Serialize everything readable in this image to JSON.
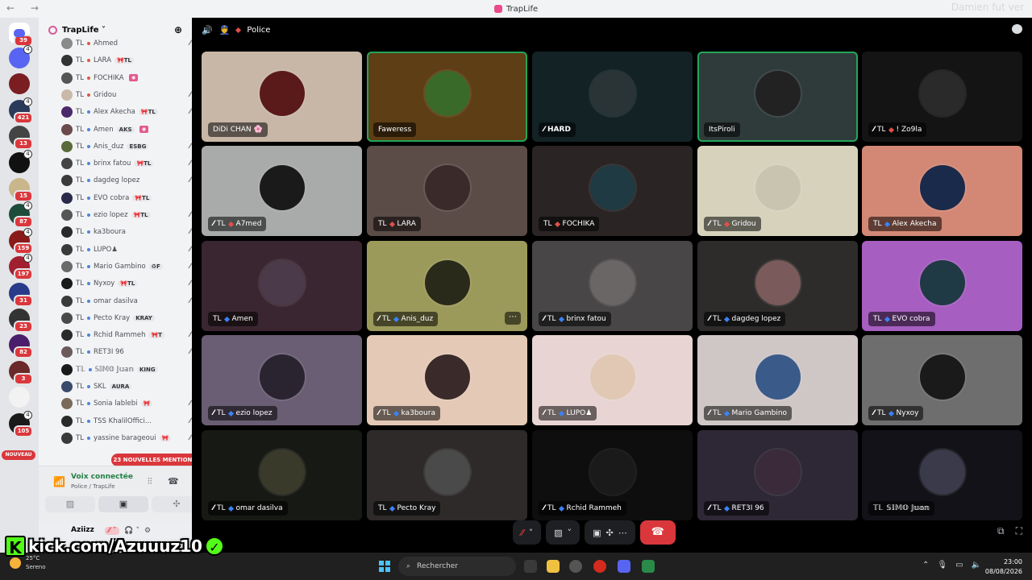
{
  "window": {
    "title": "TrapLife",
    "nav_back": "←",
    "nav_forward": "→",
    "watermark": "Damien fut ver"
  },
  "rail": {
    "discord_badge": "39",
    "nouveau": "NOUVEAU",
    "servers": [
      {
        "color": "#5865f2",
        "badge": "",
        "vc": "4"
      },
      {
        "color": "#7a1e22",
        "badge": "",
        "vc": ""
      },
      {
        "color": "#2a3a5a",
        "badge": "421",
        "vc": "4"
      },
      {
        "color": "#444444",
        "badge": "13",
        "vc": ""
      },
      {
        "color": "#111111",
        "badge": "",
        "vc": "4"
      },
      {
        "color": "#c9b68a",
        "badge": "15",
        "vc": ""
      },
      {
        "color": "#1d4d3a",
        "badge": "87",
        "vc": "4"
      },
      {
        "color": "#8a1a1a",
        "badge": "159",
        "vc": "4"
      },
      {
        "color": "#a02030",
        "badge": "197",
        "vc": "4"
      },
      {
        "color": "#2a3a8a",
        "badge": "31",
        "vc": ""
      },
      {
        "color": "#333333",
        "badge": "23",
        "vc": ""
      },
      {
        "color": "#4a1e6a",
        "badge": "82",
        "vc": ""
      },
      {
        "color": "#6a2a2a",
        "badge": "3",
        "vc": ""
      },
      {
        "color": "#f2f2f2",
        "badge": "",
        "vc": ""
      },
      {
        "color": "#1a1a1a",
        "badge": "105",
        "vc": "4"
      }
    ]
  },
  "channels": {
    "guild_name": "TrapLife ˅",
    "add_icon": "person-add-icon",
    "mentions": "23 NOUVELLES MENTIONS",
    "members": [
      {
        "tag": "TL",
        "sep": "#d95a43",
        "name": "Ahmed",
        "guild": "",
        "mute": "⁄⁄"
      },
      {
        "tag": "TL",
        "sep": "#d95a43",
        "name": "LARA",
        "guild": "🎀TL",
        "mute": ""
      },
      {
        "tag": "TL",
        "sep": "#d95a43",
        "name": "FOCHIKA",
        "guild": "",
        "mute": "stream"
      },
      {
        "tag": "TL",
        "sep": "#d95a43",
        "name": "Gridou",
        "guild": "",
        "mute": "⁄⁄"
      },
      {
        "tag": "TL",
        "sep": "#4b86d6",
        "name": "Alex Akecha",
        "guild": "🎀TL",
        "mute": "⁄⁄"
      },
      {
        "tag": "TL",
        "sep": "#4b86d6",
        "name": "Amen",
        "guild": "AKS",
        "mute": "stream"
      },
      {
        "tag": "TL",
        "sep": "#4b86d6",
        "name": "Anis_duz",
        "guild": "ESBG",
        "mute": "⁄⁄"
      },
      {
        "tag": "TL",
        "sep": "#4b86d6",
        "name": "brinx fatou",
        "guild": "🎀TL",
        "mute": "⁄⁄"
      },
      {
        "tag": "TL",
        "sep": "#4b86d6",
        "name": "dagdeg lopez",
        "guild": "",
        "mute": "⁄⁄"
      },
      {
        "tag": "TL",
        "sep": "#4b86d6",
        "name": "EVO cobra",
        "guild": "🎀TL",
        "mute": ""
      },
      {
        "tag": "TL",
        "sep": "#4b86d6",
        "name": "ezio lopez",
        "guild": "🎀TL",
        "mute": "⁄⁄"
      },
      {
        "tag": "TL",
        "sep": "#4b86d6",
        "name": "ka3boura",
        "guild": "",
        "mute": "⁄⁄"
      },
      {
        "tag": "TL",
        "sep": "#4b86d6",
        "name": "LUPO♟",
        "guild": "",
        "mute": "⁄⁄"
      },
      {
        "tag": "TL",
        "sep": "#4b86d6",
        "name": "Mario Gambino",
        "guild": "♻F",
        "mute": "⁄⁄"
      },
      {
        "tag": "TL",
        "sep": "#4b86d6",
        "name": "Nyxoy",
        "guild": "🎀TL",
        "mute": "⁄⁄"
      },
      {
        "tag": "TL",
        "sep": "#4b86d6",
        "name": "omar dasilva",
        "guild": "",
        "mute": "⁄⁄"
      },
      {
        "tag": "TL",
        "sep": "#4b86d6",
        "name": "Pecto Kray",
        "guild": "KRAY",
        "mute": ""
      },
      {
        "tag": "TL",
        "sep": "#4b86d6",
        "name": "Rchid Rammeh",
        "guild": "🎀T",
        "mute": "⁄⁄"
      },
      {
        "tag": "TL",
        "sep": "#4b86d6",
        "name": "RET3I 96",
        "guild": "",
        "mute": "⁄⁄"
      },
      {
        "tag": "𝕋𝕃",
        "sep": "#4b86d6",
        "name": "𝕊𝕀𝕄𝕆 𝕁𝕦𝕒𝕟",
        "guild": "KING",
        "mute": ""
      },
      {
        "tag": "TL",
        "sep": "#4b86d6",
        "name": "SKL",
        "guild": "AURA",
        "mute": ""
      },
      {
        "tag": "TL",
        "sep": "#4b86d6",
        "name": "Sonia lablebi",
        "guild": "🎀",
        "mute": "⁄⁄"
      },
      {
        "tag": "TL",
        "sep": "#4b86d6",
        "name": "TSS KhalilOffici...",
        "guild": "",
        "mute": "⁄⁄"
      },
      {
        "tag": "TL",
        "sep": "#4b86d6",
        "name": "yassine barageoui",
        "guild": "🎀",
        "mute": "⁄⁄"
      }
    ],
    "voice_status": "Voix connectée",
    "voice_channel": "Police / TrapLife",
    "user_name": "Aziizz"
  },
  "kick": {
    "letter": "K",
    "url": "kick.com/Azuuuz10",
    "check": "✓"
  },
  "voice": {
    "channel": "Police",
    "tiles": [
      {
        "name": "DiDi CHAN 🌸",
        "tag": "",
        "dot": "",
        "mic": "",
        "bg": "#c8b7a6",
        "av": "#5a1a1a",
        "spk": false,
        "bold": false
      },
      {
        "name": "Faweress",
        "tag": "",
        "dot": "",
        "mic": "",
        "bg": "#5e3e14",
        "av": "#3a6a2a",
        "spk": true,
        "bold": false
      },
      {
        "name": "HARD",
        "tag": "",
        "dot": "",
        "mic": "⁄⁄",
        "bg": "#132325",
        "av": "#2a3436",
        "spk": false,
        "bold": true
      },
      {
        "name": "ItsPiroli",
        "tag": "",
        "dot": "",
        "mic": "",
        "bg": "#2f3b3a",
        "av": "#222222",
        "spk": true,
        "bold": false
      },
      {
        "name": "! Zo9la",
        "tag": "TL",
        "dot": "#e0504a",
        "mic": "⁄⁄",
        "bg": "#141414",
        "av": "#2a2a2a",
        "spk": false,
        "bold": false
      },
      {
        "name": "A7med",
        "tag": "TL",
        "dot": "#e0504a",
        "mic": "⁄⁄",
        "bg": "#a9aaaa",
        "av": "#1a1a1a",
        "spk": false,
        "bold": false
      },
      {
        "name": "LARA",
        "tag": "TL",
        "dot": "#e0504a",
        "mic": "",
        "bg": "#5c4c48",
        "av": "#3a2a2a",
        "spk": false,
        "bold": false
      },
      {
        "name": "FOCHIKA",
        "tag": "TL",
        "dot": "#e0504a",
        "mic": "",
        "bg": "#2a2424",
        "av": "#1f3a42",
        "spk": false,
        "bold": false
      },
      {
        "name": "Gridou",
        "tag": "TL",
        "dot": "#e0504a",
        "mic": "⁄⁄",
        "bg": "#d6d2bc",
        "av": "#c9c4b0",
        "spk": false,
        "bold": false
      },
      {
        "name": "Alex Akecha",
        "tag": "TL",
        "dot": "#3b82f6",
        "mic": "",
        "bg": "#d38876",
        "av": "#1a2a4a",
        "spk": false,
        "bold": false
      },
      {
        "name": "Amen",
        "tag": "TL",
        "dot": "#3b82f6",
        "mic": "",
        "bg": "#3a2630",
        "av": "#4a3a4a",
        "spk": false,
        "bold": false
      },
      {
        "name": "Anis_duz",
        "tag": "TL",
        "dot": "#3b82f6",
        "mic": "⁄⁄",
        "bg": "#9c9a5a",
        "av": "#2a2a1a",
        "spk": false,
        "bold": false,
        "more": true
      },
      {
        "name": "brinx fatou",
        "tag": "TL",
        "dot": "#3b82f6",
        "mic": "⁄⁄",
        "bg": "#484646",
        "av": "#6a6666",
        "spk": false,
        "bold": false
      },
      {
        "name": "dagdeg lopez",
        "tag": "TL",
        "dot": "#3b82f6",
        "mic": "⁄⁄",
        "bg": "#2e2c2a",
        "av": "#7a5a5a",
        "spk": false,
        "bold": false
      },
      {
        "name": "EVO cobra",
        "tag": "TL",
        "dot": "#3b82f6",
        "mic": "",
        "bg": "#a65ec0",
        "av": "#1f3a44",
        "spk": false,
        "bold": false
      },
      {
        "name": "ezio lopez",
        "tag": "TL",
        "dot": "#3b82f6",
        "mic": "⁄⁄",
        "bg": "#6a5e74",
        "av": "#2a2430",
        "spk": false,
        "bold": false
      },
      {
        "name": "ka3boura",
        "tag": "TL",
        "dot": "#3b82f6",
        "mic": "⁄⁄",
        "bg": "#e4c9b6",
        "av": "#3a2a2a",
        "spk": false,
        "bold": false
      },
      {
        "name": "LUPO♟",
        "tag": "TL",
        "dot": "#3b82f6",
        "mic": "⁄⁄",
        "bg": "#e8d4d2",
        "av": "#e0c8b4",
        "spk": false,
        "bold": false
      },
      {
        "name": "Mario Gambino",
        "tag": "TL",
        "dot": "#3b82f6",
        "mic": "⁄⁄",
        "bg": "#cfc6c6",
        "av": "#3a5a8a",
        "spk": false,
        "bold": false
      },
      {
        "name": "Nyxoy",
        "tag": "TL",
        "dot": "#3b82f6",
        "mic": "⁄⁄",
        "bg": "#6e6e6e",
        "av": "#1a1a1a",
        "spk": false,
        "bold": false
      },
      {
        "name": "omar dasilva",
        "tag": "TL",
        "dot": "#3b82f6",
        "mic": "⁄⁄",
        "bg": "#171a14",
        "av": "#3a3a2a",
        "spk": false,
        "bold": false
      },
      {
        "name": "Pecto Kray",
        "tag": "TL",
        "dot": "#3b82f6",
        "mic": "",
        "bg": "#2e2a2a",
        "av": "#4a4a4a",
        "spk": false,
        "bold": false
      },
      {
        "name": "Rchid Rammeh",
        "tag": "TL",
        "dot": "#3b82f6",
        "mic": "⁄⁄",
        "bg": "#0e0e0e",
        "av": "#1a1a1a",
        "spk": false,
        "bold": false
      },
      {
        "name": "RET3I 96",
        "tag": "TL",
        "dot": "#3b82f6",
        "mic": "⁄⁄",
        "bg": "#2e2836",
        "av": "#3a2a3a",
        "spk": false,
        "bold": false
      },
      {
        "name": "𝕊𝕀𝕄𝕆 𝕁𝕦𝕒𝕟",
        "tag": "𝕋𝕃",
        "dot": "",
        "mic": "",
        "bg": "#121218",
        "av": "#3a3a4a",
        "spk": false,
        "bold": true
      }
    ]
  },
  "taskbar": {
    "temp": "25°C",
    "weather": "Sereno",
    "search": "Rechercher",
    "time": "23:00",
    "date": "08/08/2026"
  }
}
